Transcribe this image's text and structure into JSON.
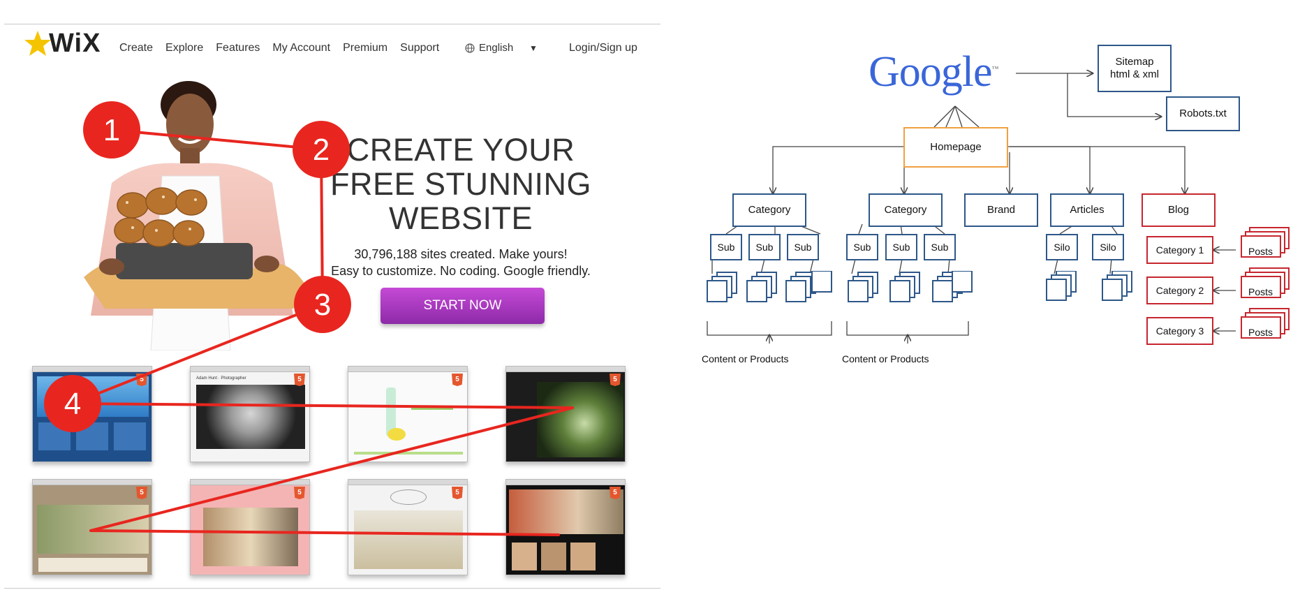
{
  "wix": {
    "logo_text": "WiX",
    "nav": [
      "Create",
      "Explore",
      "Features",
      "My Account",
      "Premium",
      "Support"
    ],
    "language": "English",
    "login": "Login/Sign up",
    "hero_title_lines": [
      "CREATE YOUR",
      "FREE STUNNING",
      "WEBSITE"
    ],
    "hero_sub_lines": [
      "30,796,188 sites created. Make yours!",
      "Easy to customize. No coding. Google friendly."
    ],
    "start_button": "START NOW",
    "badge_label": "5",
    "annotations": [
      "1",
      "2",
      "3",
      "4"
    ],
    "thumb_texts": {
      "photographer": "Adam Hunt · Photographer"
    }
  },
  "diagram": {
    "google": "Google",
    "tm": "™",
    "sitemap": "Sitemap html & xml",
    "sitemap_lines": [
      "Sitemap",
      "html & xml"
    ],
    "robots": "Robots.txt",
    "homepage": "Homepage",
    "category": "Category",
    "brand": "Brand",
    "articles": "Articles",
    "blog": "Blog",
    "sub": "Sub",
    "silo": "Silo",
    "posts": "Posts",
    "category_1": "Category 1",
    "category_2": "Category 2",
    "category_3": "Category 3",
    "content_or_products": "Content or Products"
  },
  "colors": {
    "annotation_red": "#e8261f",
    "button_purple": "#a83ac0",
    "box_blue": "#2d5789",
    "box_red": "#c6262e",
    "box_orange": "#f1a042"
  }
}
